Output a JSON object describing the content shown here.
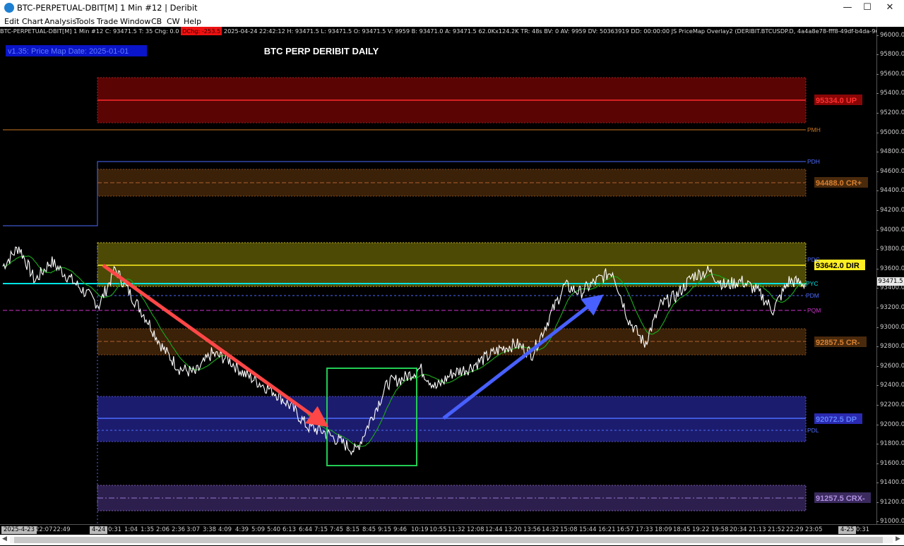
{
  "window": {
    "title": "BTC-PERPETUAL-DBIT[M]  1 Min  #12 | Deribit",
    "minimize": "—",
    "maximize": "☐",
    "close": "✕"
  },
  "menu": [
    "Edit",
    "Chart",
    "Analysis",
    "Tools",
    "Trade",
    "Window",
    "CB",
    "CW",
    "Help"
  ],
  "infobar": {
    "symbol": "BTC-PERPETUAL-DBIT[M]  1 Min  #12",
    "c": "C: 93471.5",
    "t": "T: 35",
    "chg": "Chg: 0.0",
    "dchg": "DChg: -253.5",
    "rest": "2025-04-24 22:42:12 H: 93471.5  L: 93471.5  O: 93471.5  V: 9959  B: 93471.0  A: 93471.5  62.0Kx124.2K  TR: 48s  BV: 0  AV: 9959  DV: 50363919  DD: 00:00:00  JS PriceMap Overlay2   (DERIBIT.BTCUSDP.D, 4a4a8e78-fff8-49df-b4da-96f273b4307e, PriceMa"
  },
  "chart_title": "BTC PERP DERIBIT DAILY",
  "pricemap_tag": "v1.35: Price Map Date: 2025-01-01",
  "colors": {
    "up": "#ff2a2a",
    "crplus": "#b85a14",
    "dir": "#ffee22",
    "crminus": "#b85a14",
    "dp": "#3a3aff",
    "crxminus": "#9a6ad0",
    "pyc": "#00e5e5",
    "pqm": "#cc33cc",
    "pmh": "#cc7722",
    "pdh": "#4d6cff",
    "arrow_down": "#ff4747",
    "arrow_up": "#4760ff",
    "box": "#22cc55",
    "price_line": "#ffffff",
    "ma_line": "#1aa01a"
  },
  "level_labels": {
    "up": "95334.0 UP",
    "crplus": "94488.0 CR+",
    "dir": "93642.0 DIR",
    "crminus": "92857.5 CR-",
    "dp": "92072.5 DP",
    "crxminus": "91257.5 CRX-",
    "pmh": "PMH",
    "pdh": "PDH",
    "pdc": "PDC",
    "pyc": "PYC",
    "pdm": "PDM",
    "pqm": "PQM",
    "pdl": "PDL"
  },
  "price_axis": [
    "96000.0",
    "95800.0",
    "95600.0",
    "95400.0",
    "95200.0",
    "95000.0",
    "94800.0",
    "94600.0",
    "94400.0",
    "94200.0",
    "94000.0",
    "93800.0",
    "93600.0",
    "93400.0",
    "93200.0",
    "93000.0",
    "92800.0",
    "92600.0",
    "92400.0",
    "92200.0",
    "92000.0",
    "91800.0",
    "91600.0",
    "91400.0",
    "91200.0",
    "91000.0"
  ],
  "current_price": "93471.5",
  "time_axis": {
    "date_start": "2025-4-23",
    "date_mid": "4-24",
    "date_end": "4-25",
    "labels": [
      "22:07",
      "22:49",
      "0:31",
      "1:04",
      "1:35",
      "2:06",
      "2:36",
      "3:07",
      "3:38",
      "4:09",
      "4:39",
      "5:09",
      "5:40",
      "6:13",
      "6:44",
      "7:15",
      "7:45",
      "8:15",
      "8:45",
      "9:15",
      "9:46",
      "10:19",
      "10:55",
      "11:32",
      "12:08",
      "12:44",
      "13:20",
      "13:56",
      "14:32",
      "15:08",
      "15:44",
      "16:21",
      "16:57",
      "17:33",
      "18:09",
      "18:45",
      "19:22",
      "19:58",
      "20:34",
      "21:13",
      "21:52",
      "22:29",
      "23:05",
      "0:31"
    ]
  },
  "chart_data": {
    "type": "line",
    "title": "BTC PERP DERIBIT DAILY",
    "ylim": [
      91000,
      96000
    ],
    "series": [
      {
        "name": "BTC-PERPETUAL-DBIT[M]",
        "note_x": "time",
        "x": [
          "22:00",
          "22:30",
          "23:00",
          "0:00",
          "0:30",
          "1:00",
          "1:30",
          "2:00",
          "2:30",
          "3:00",
          "3:30",
          "4:00",
          "4:30",
          "5:00",
          "5:30",
          "6:00",
          "6:30",
          "7:00",
          "7:30",
          "8:00",
          "8:15",
          "8:30",
          "8:45",
          "9:00",
          "9:30",
          "10:00",
          "10:30",
          "11:00",
          "11:30",
          "12:00",
          "12:30",
          "13:00",
          "13:30",
          "14:00",
          "14:30",
          "15:00",
          "15:30",
          "16:00",
          "16:30",
          "17:00",
          "17:30",
          "18:00",
          "18:30",
          "19:00",
          "19:30",
          "20:00",
          "20:30",
          "21:00",
          "21:30",
          "22:00",
          "22:30"
        ],
        "values": [
          93650,
          93850,
          93500,
          93700,
          93550,
          93400,
          93250,
          93620,
          93350,
          93100,
          92800,
          92600,
          92550,
          92750,
          92700,
          92550,
          92450,
          92350,
          92200,
          92000,
          91950,
          91850,
          91750,
          92100,
          92450,
          92500,
          92600,
          92400,
          92550,
          92600,
          92700,
          92800,
          92850,
          92750,
          93100,
          93450,
          93380,
          93500,
          93600,
          93100,
          92850,
          93250,
          93350,
          93550,
          93600,
          93450,
          93500,
          93400,
          93200,
          93500,
          93470
        ]
      }
    ],
    "levels": [
      {
        "name": "UP",
        "value": 95334.0
      },
      {
        "name": "CR+",
        "value": 94488.0
      },
      {
        "name": "DIR",
        "value": 93642.0
      },
      {
        "name": "CR-",
        "value": 92857.5
      },
      {
        "name": "DP",
        "value": 92072.5
      },
      {
        "name": "CRX-",
        "value": 91257.5
      }
    ]
  }
}
